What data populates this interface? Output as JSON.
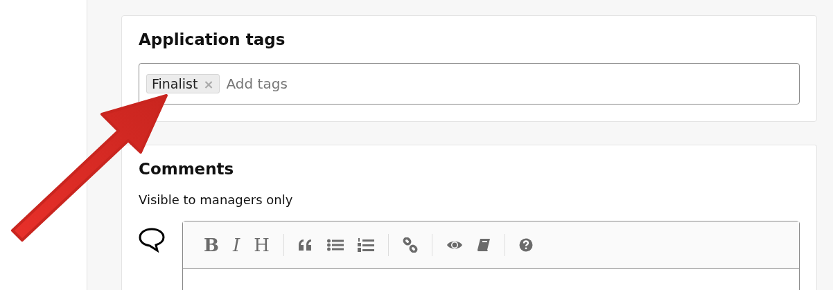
{
  "tags_card": {
    "title": "Application tags",
    "tags": [
      {
        "label": "Finalist",
        "remove": "×"
      }
    ],
    "placeholder": "Add tags"
  },
  "comments_card": {
    "title": "Comments",
    "subtitle": "Visible to managers only",
    "toolbar": [
      [
        {
          "kind": "bold",
          "label": "B"
        },
        {
          "kind": "italic",
          "label": "I"
        },
        {
          "kind": "heading",
          "label": "H"
        }
      ],
      [
        {
          "kind": "quote"
        },
        {
          "kind": "bullet-list"
        },
        {
          "kind": "numbered-list"
        }
      ],
      [
        {
          "kind": "link"
        }
      ],
      [
        {
          "kind": "preview"
        },
        {
          "kind": "guide"
        }
      ],
      [
        {
          "kind": "help"
        }
      ]
    ]
  }
}
